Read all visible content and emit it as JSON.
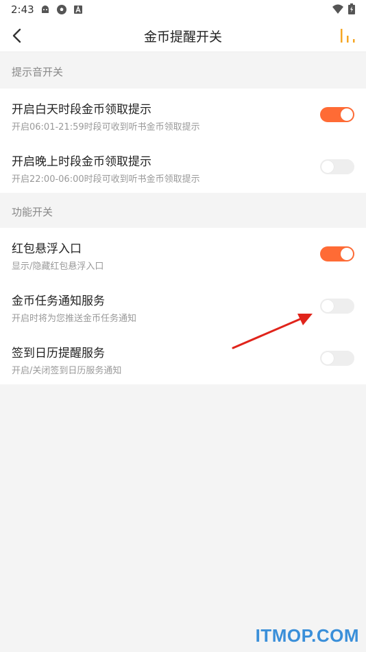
{
  "status_bar": {
    "time": "2:43",
    "left_icons": [
      "android-robot-icon",
      "soccer-ball-icon",
      "a-badge-icon"
    ],
    "right_icons": [
      "wifi-icon",
      "battery-icon"
    ]
  },
  "nav": {
    "title": "金币提醒开关",
    "accent_color": "#f5a623"
  },
  "sections": [
    {
      "header": "提示音开关",
      "rows": [
        {
          "title": "开启白天时段金币领取提示",
          "subtitle": "开启06:01-21:59时段可收到听书金币领取提示",
          "enabled": true
        },
        {
          "title": "开启晚上时段金币领取提示",
          "subtitle": "开启22:00-06:00时段可收到听书金币领取提示",
          "enabled": false
        }
      ]
    },
    {
      "header": "功能开关",
      "rows": [
        {
          "title": "红包悬浮入口",
          "subtitle": "显示/隐藏红包悬浮入口",
          "enabled": true
        },
        {
          "title": "金币任务通知服务",
          "subtitle": "开启时将为您推送金币任务通知",
          "enabled": false
        },
        {
          "title": "签到日历提醒服务",
          "subtitle": "开启/关闭签到日历服务通知",
          "enabled": false
        }
      ]
    }
  ],
  "annotation": {
    "arrow_color": "#e0241b",
    "points_to": "金币任务通知服务"
  },
  "watermark": "ITMOP.COM",
  "colors": {
    "toggle_on": "#ff6b35",
    "toggle_off": "#eeeeee"
  }
}
